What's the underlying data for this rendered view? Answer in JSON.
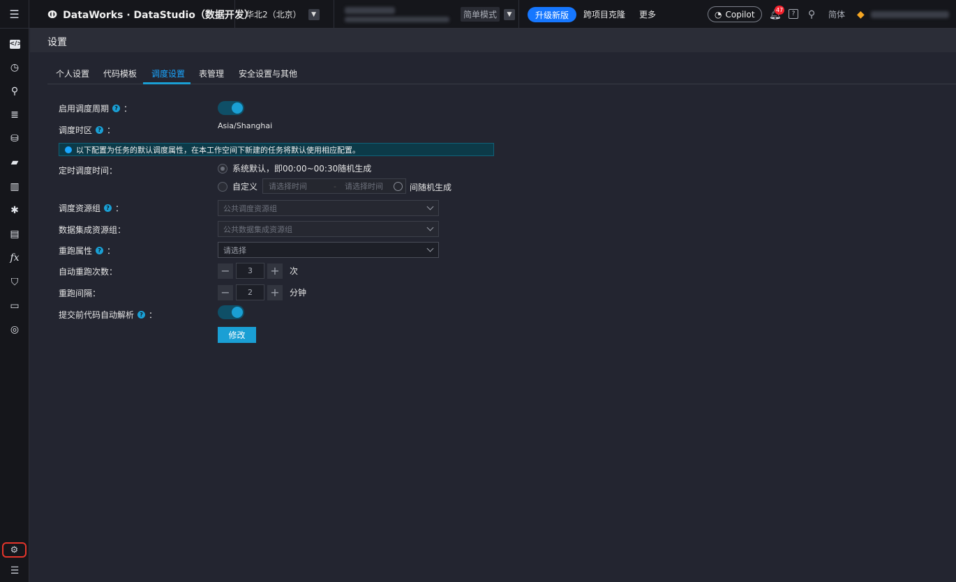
{
  "topbar": {
    "menu_icon": "menu-icon",
    "logo": "DataWorks · DataStudio（数据开发）",
    "region": "华北2（北京）",
    "mode": "简单模式",
    "upgrade": "升级新版",
    "clone": "跨项目克隆",
    "more": "更多",
    "copilot": "Copilot",
    "notification_count": "47",
    "help": "?",
    "language": "简体"
  },
  "sidebar": {
    "icons": [
      "code-icon",
      "clock-icon",
      "search-icon",
      "list-icon",
      "database-icon",
      "toolbox-icon",
      "trash-icon",
      "puzzle-icon",
      "table-icon",
      "function-icon",
      "shield-icon",
      "form-icon",
      "pointer-icon"
    ],
    "function_glyph": "fx"
  },
  "page": {
    "title": "设置"
  },
  "tabs": [
    "个人设置",
    "代码模板",
    "调度设置",
    "表管理",
    "安全设置与其他"
  ],
  "form": {
    "enable_cycle_label": "启用调度周期",
    "timezone_label": "调度时区",
    "timezone_value": "Asia/Shanghai",
    "notice": "以下配置为任务的默认调度属性，在本工作空间下新建的任务将默认使用相应配置。",
    "schedule_time_label": "定时调度时间：",
    "radio_default": "系统默认，即00:00~00:30随机生成",
    "radio_custom": "自定义",
    "start_placeholder": "请选择时间",
    "range_sep": "-",
    "end_placeholder": "请选择时间",
    "range_suffix": "间随机生成",
    "resource_group_label": "调度资源组",
    "resource_group_value": "公共调度资源组",
    "integration_group_label": "数据集成资源组：",
    "integration_group_value": "公共数据集成资源组",
    "rerun_label": "重跑属性",
    "rerun_placeholder": "请选择",
    "auto_rerun_label": "自动重跑次数：",
    "auto_rerun_value": "3",
    "auto_rerun_unit": "次",
    "interval_label": "重跑间隔：",
    "interval_value": "2",
    "interval_unit": "分钟",
    "auto_parse_label": "提交前代码自动解析",
    "colon": "：",
    "submit": "修改"
  },
  "colors": {
    "accent": "#1a9fd4",
    "brand_blue": "#1677ff",
    "highlight_border": "#e5352b"
  }
}
